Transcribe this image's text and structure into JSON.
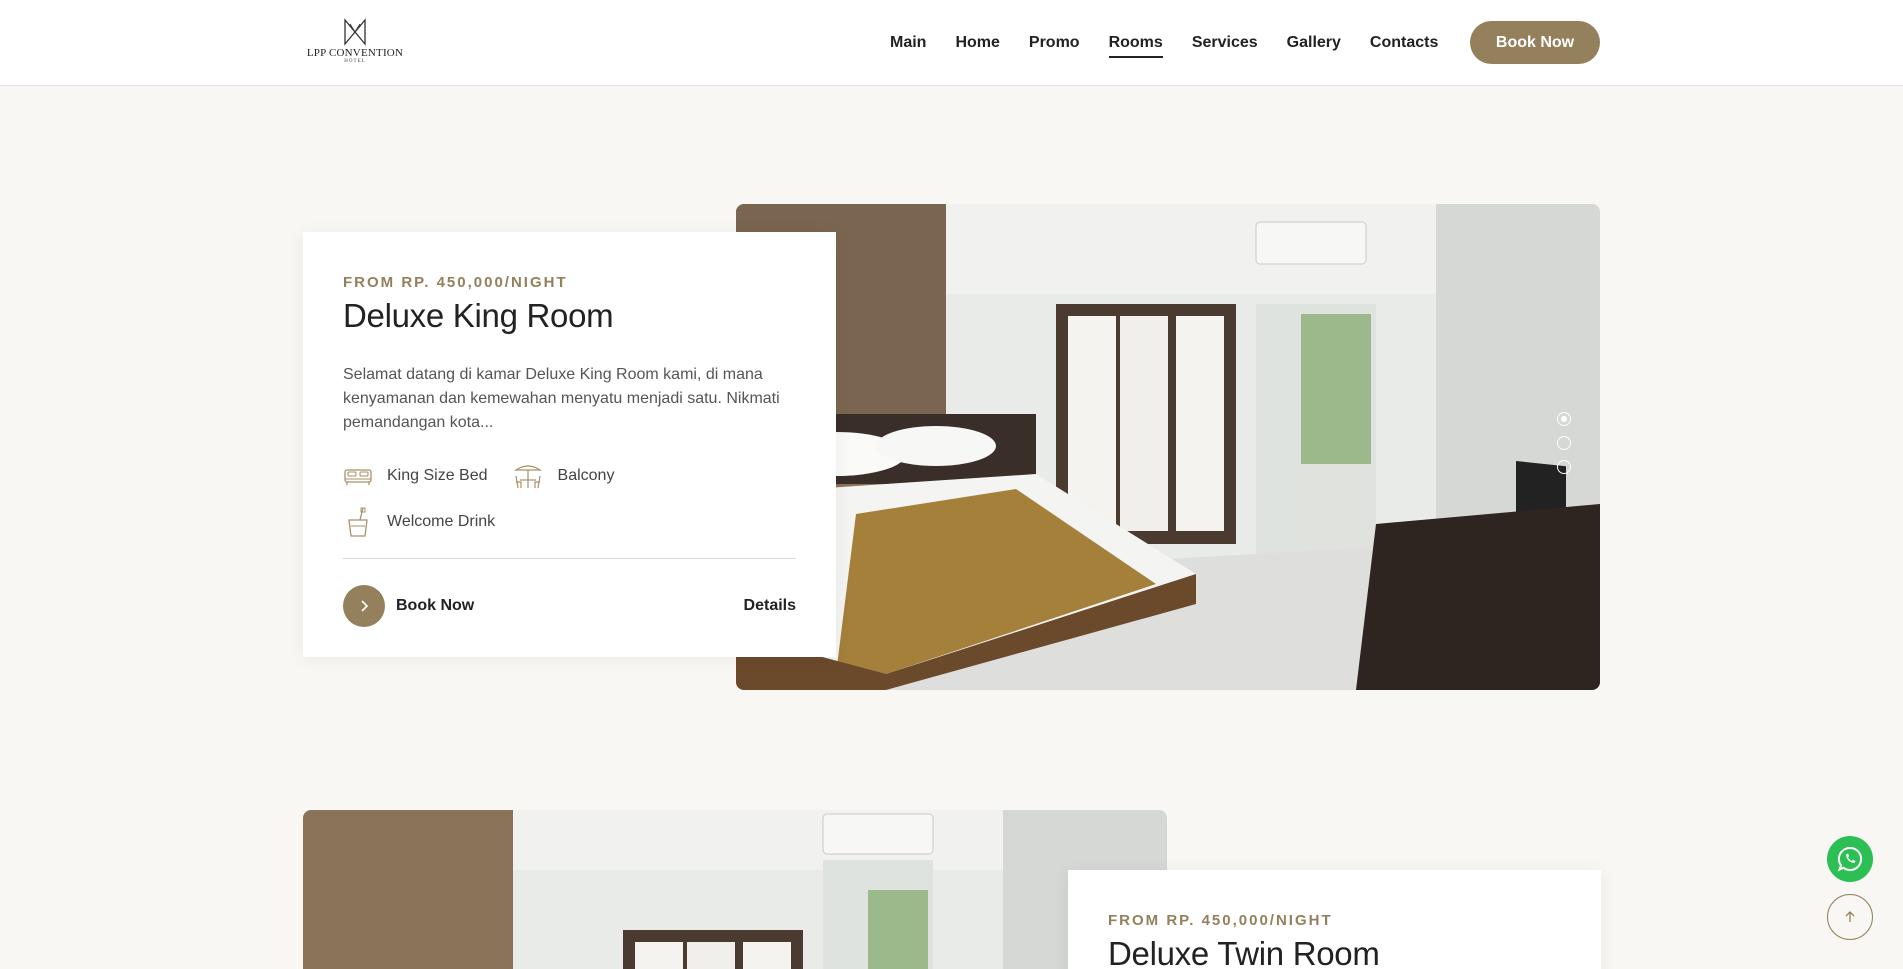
{
  "header": {
    "logo_text": "LPP CONVENTION",
    "logo_sub": "HOTEL",
    "nav": [
      "Main",
      "Home",
      "Promo",
      "Rooms",
      "Services",
      "Gallery",
      "Contacts"
    ],
    "active_nav": "Rooms",
    "book_label": "Book Now"
  },
  "rooms": [
    {
      "price": "FROM RP. 450,000/NIGHT",
      "title": "Deluxe King Room",
      "description": "Selamat datang di kamar Deluxe King Room kami, di mana kenyamanan dan kemewahan menyatu menjadi satu. Nikmati pemandangan kota...",
      "amenities": [
        {
          "icon": "bed-icon",
          "label": "King Size Bed"
        },
        {
          "icon": "balcony-icon",
          "label": "Balcony"
        },
        {
          "icon": "welcome-drink-icon",
          "label": "Welcome Drink"
        }
      ],
      "book_label": "Book Now",
      "details_label": "Details",
      "slides": 3,
      "active_slide": 1
    },
    {
      "price": "FROM RP. 450,000/NIGHT",
      "title": "Deluxe Twin Room"
    }
  ],
  "colors": {
    "accent": "#94805c",
    "background": "#f8f7f3",
    "whatsapp": "#2bbf54"
  },
  "floating": {
    "whatsapp_icon": "whatsapp-icon",
    "top_icon": "arrow-up-icon"
  }
}
